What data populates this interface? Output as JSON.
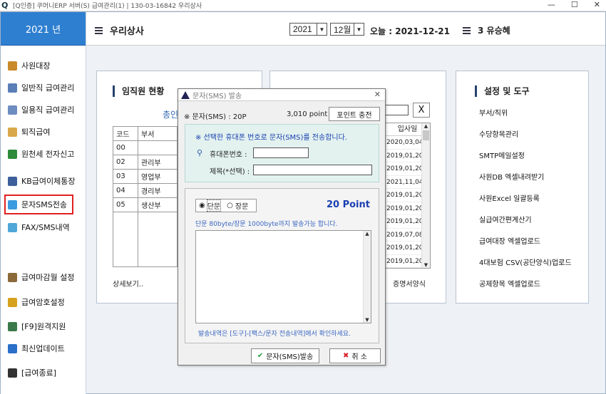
{
  "titlebar": {
    "title": "[Q인증] 쿠머니ERP 서버(S)   급여관리(1)  | 130-03-16842  우리상사",
    "min": "—",
    "max": "☐",
    "close": "✕"
  },
  "sidebar": {
    "year_tab": "2021 년",
    "items": [
      {
        "label": "사원대장",
        "color": "#c98a2a"
      },
      {
        "label": "일반직 급여관리",
        "color": "#5a7fb8"
      },
      {
        "label": "일용직 급여관리",
        "color": "#6d8cc0"
      },
      {
        "label": "퇴직급여",
        "color": "#d8a84a"
      },
      {
        "label": "원천세 전자신고",
        "color": "#2d8a3a"
      },
      {
        "label": "KB급여이체통장",
        "color": "#3d5f9a"
      },
      {
        "label": "문자SMS전송",
        "color": "#3a9be0"
      },
      {
        "label": "FAX/SMS내역",
        "color": "#4fa7d8"
      },
      {
        "label": "급여마감월 설정",
        "color": "#8a6a3a"
      },
      {
        "label": "급여암호설정",
        "color": "#d6a21e"
      },
      {
        "label": "[F9]원격지원",
        "color": "#3a7a4a"
      },
      {
        "label": "최신업데이트",
        "color": "#2a6fc8"
      },
      {
        "label": "[급여종료]",
        "color": "#333333"
      }
    ]
  },
  "topbar": {
    "company": "우리상사",
    "year_value": "2021",
    "month_value": "12월",
    "today_label": "오늘 : 2021-12-21",
    "users_label": "3 유승혜"
  },
  "panels": {
    "employee": {
      "title": "임직원 현황",
      "subtitle": "총인",
      "headers": [
        "코드",
        "부서"
      ],
      "rows": [
        [
          "00",
          ""
        ],
        [
          "02",
          "관리부"
        ],
        [
          "03",
          "영업부"
        ],
        [
          "04",
          "경리부"
        ],
        [
          "05",
          "생산부"
        ]
      ],
      "more": "상세보기.."
    },
    "middle": {
      "search_close": "X",
      "hire_header": "입사일",
      "hire_dates": [
        "2020,03,04",
        "2019,01,20",
        "2019,01,20",
        "2021,11,04",
        "2019,01,20",
        "2019,01,20",
        "2019,01,20",
        "2019,07,08",
        "2019,01,20",
        "2019,01,20"
      ],
      "footer": "증명서양식"
    },
    "tools": {
      "title": "설정 및 도구",
      "items": [
        "부서/직위",
        "수당항목관리",
        "SMTP메일설정",
        "사원DB 엑셀내려받기",
        "사원Excel 일괄등록",
        "실급여간편계산기",
        "급여대장 엑셀업로드",
        "4대보험 CSV(공단양식)업로드",
        "공제항목 엑셀업로드"
      ]
    }
  },
  "dialog": {
    "title": "문자(SMS) 발송",
    "balance_label": "※ 문자(SMS) : 20P",
    "points": "3,010 point",
    "charge_button": "포인트 충전",
    "notice": "※ 선택한 휴대폰 번호로 문자(SMS)를 전송합니다.",
    "phone_label": "휴대폰번호 :",
    "subject_label": "제목(*선택) :",
    "type_short": "단문",
    "type_long": "장문",
    "point_cost": "20 Point",
    "limit_text": "단문 80byte/장문 1000byte까지 발송가능 합니다.",
    "history_text": "발송내역은 [도구]-[팩스/문자 전송내역]에서 확인하세요.",
    "send_button": "문자(SMS)발송",
    "cancel_button": "취 소"
  }
}
